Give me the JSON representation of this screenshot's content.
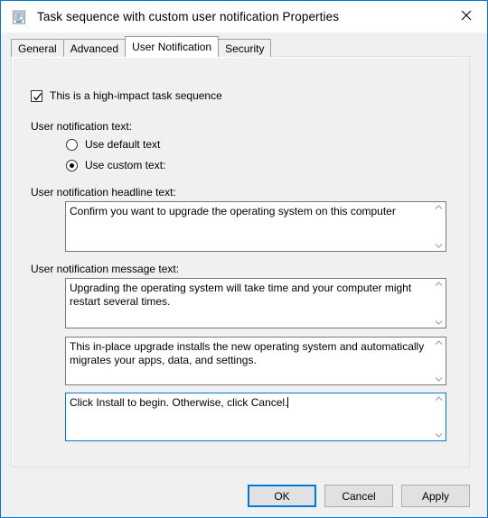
{
  "window": {
    "title": "Task sequence with custom user notification Properties",
    "icon": "properties-document-icon",
    "close_label": "✕",
    "accent_color": "#0078d7"
  },
  "tabs": [
    {
      "label": "General",
      "active": false
    },
    {
      "label": "Advanced",
      "active": false
    },
    {
      "label": "User Notification",
      "active": true
    },
    {
      "label": "Security",
      "active": false
    }
  ],
  "form": {
    "high_impact_checkbox": {
      "label": "This is a high-impact task sequence",
      "checked": true
    },
    "notification_text_label": "User notification text:",
    "radios": [
      {
        "label": "Use default text",
        "selected": false
      },
      {
        "label": "Use custom text:",
        "selected": true
      }
    ],
    "headline_label": "User notification headline text:",
    "headline_value": "Confirm you want to upgrade the operating system on this computer",
    "message_label": "User notification message text:",
    "message_value_1": "Upgrading the operating system will take time and your computer might restart several times.",
    "message_value_2": "This in-place upgrade installs the new operating system and automatically migrates your apps, data, and settings.",
    "message_value_3": "Click Install to begin. Otherwise, click Cancel."
  },
  "footer": {
    "ok_label": "OK",
    "cancel_label": "Cancel",
    "apply_label": "Apply"
  }
}
